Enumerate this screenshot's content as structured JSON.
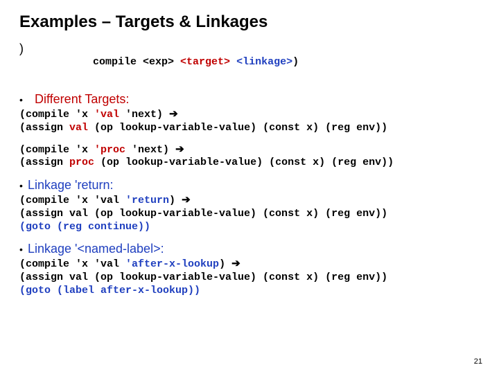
{
  "title": "Examples – Targets & Linkages",
  "sig_paren": ")",
  "sig_prefix": "compile <exp> ",
  "sig_target": "<target>",
  "sig_sep": " ",
  "sig_linkage": "<linkage>",
  "sig_close": ")",
  "heads": {
    "diff_targets": "Different Targets:",
    "linkage_return": "Linkage 'return:",
    "linkage_named": "Linkage '<named-label>:"
  },
  "bullets": {
    "dot": "•"
  },
  "arrow": "➔",
  "code": {
    "b1_l1_a": "(compile 'x ",
    "b1_l1_b": "'val",
    "b1_l1_c": " 'next) ",
    "b1_l2_a": "(assign ",
    "b1_l2_b": "val",
    "b1_l2_c": " (op lookup-variable-value) (const x) (reg env))",
    "b2_l1_a": "(compile 'x ",
    "b2_l1_b": "'proc",
    "b2_l1_c": " 'next) ",
    "b2_l2_a": "(assign ",
    "b2_l2_b": "proc",
    "b2_l2_c": " (op lookup-variable-value) (const x) (reg env))",
    "b3_l1_a": "(compile 'x 'val ",
    "b3_l1_b": "'return",
    "b3_l1_c": ") ",
    "b3_l2": "(assign val (op lookup-variable-value) (const x) (reg env))",
    "b3_l3_a": "(goto (reg continue))",
    "b4_l1_a": "(compile 'x 'val ",
    "b4_l1_b": "'after-x-lookup",
    "b4_l1_c": ") ",
    "b4_l2": "(assign val (op lookup-variable-value) (const x) (reg env))",
    "b4_l3_a": "(goto (label after-x-lookup))"
  },
  "pagenum": "21"
}
